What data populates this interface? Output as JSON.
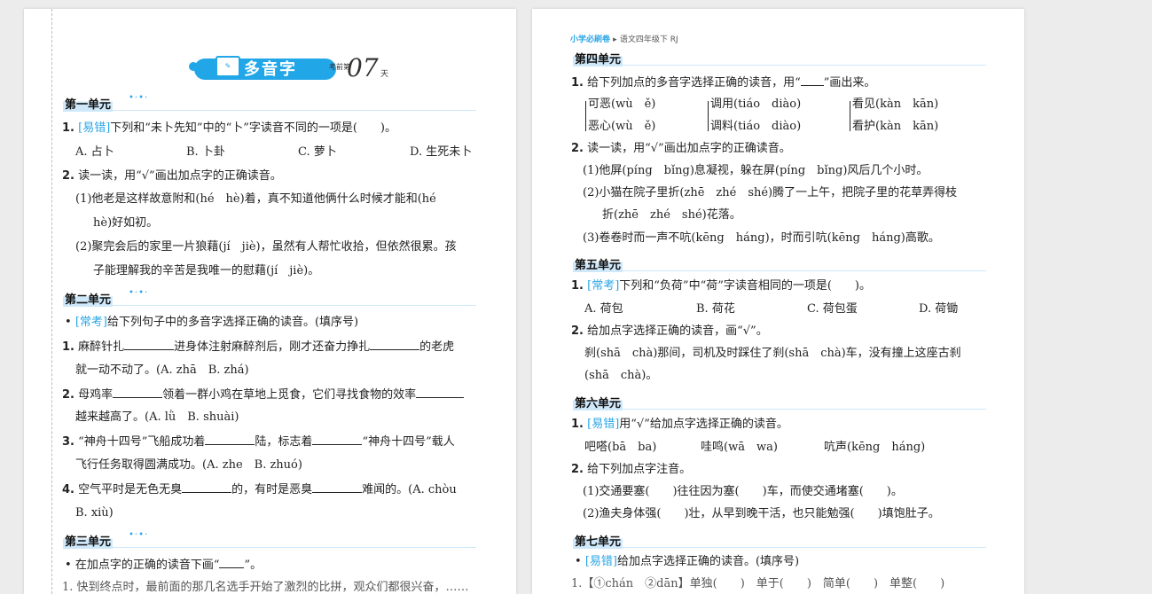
{
  "left": {
    "title": {
      "text": "多音字",
      "prefix": "考前第",
      "day": "07",
      "suffix": "天",
      "book_icon": "book-icon"
    },
    "u1": {
      "heading": "第一单元",
      "q1": {
        "num": "1.",
        "tag": "[易错]",
        "text": "下列和“未卜先知”中的“卜”字读音不同的一项是(　　)。",
        "opts": [
          "A. 占卜",
          "B. 卜卦",
          "C. 萝卜",
          "D. 生死未卜"
        ]
      },
      "q2": {
        "num": "2.",
        "text": "读一读，用“√”画出加点字的正确读音。",
        "s1a": "(1)他老是这样故意附和(hé　hè)着，真不知道他俩什么时候才能和(hé",
        "s1b": "hè)好如初。",
        "s2a": "(2)聚完会后的家里一片狼藉(jí　jiè)，虽然有人帮忙收拾，但依然很累。孩",
        "s2b": "子能理解我的辛苦是我唯一的慰藉(jí　jiè)。"
      }
    },
    "u2": {
      "heading": "第二单元",
      "intro": {
        "tag": "[常考]",
        "text": "给下列句子中的多音字选择正确的读音。(填序号)"
      },
      "q1": {
        "num": "1.",
        "a": "麻醉针扎",
        "b": "进身体注射麻醉剂后，刚才还奋力挣扎",
        "c": "的老虎",
        "d": "就一动不动了。(A. zhā　B. zhá)"
      },
      "q2": {
        "num": "2.",
        "a": "母鸡率",
        "b": "领着一群小鸡在草地上觅食，它们寻找食物的效率",
        "d": "越来越高了。(A. lǜ　B. shuài)"
      },
      "q3": {
        "num": "3.",
        "a": "“神舟十四号”飞船成功着",
        "b": "陆，标志着",
        "c": "“神舟十四号”载人",
        "d": "飞行任务取得圆满成功。(A. zhe　B. zhuó)"
      },
      "q4": {
        "num": "4.",
        "a": "空气平时是无色无臭",
        "b": "的，有时是恶臭",
        "c": "难闻的。(A. chòu",
        "d": "B. xiù)"
      }
    },
    "u3": {
      "heading": "第三单元",
      "intro": "在加点字的正确的读音下画“",
      "intro_end": "”。",
      "cut": "1. 快到终点时，最前面的那几名选手开始了激烈的比拼，观众们都很兴奋，……"
    }
  },
  "right": {
    "header": {
      "series": "小学必刷卷",
      "arrow": "▸",
      "grade": "语文四年级下 RJ"
    },
    "u4": {
      "heading": "第四单元",
      "q1": {
        "num": "1.",
        "a": "给下列加点的多音字选择正确的读音，用“",
        "b": "”画出来。",
        "row1": [
          "可恶(wù　ě)",
          "调用(tiáo　diào)",
          "看见(kàn　kān)"
        ],
        "row2": [
          "恶心(wù　ě)",
          "调料(tiáo　diào)",
          "看护(kàn　kān)"
        ]
      },
      "q2": {
        "num": "2.",
        "text": "读一读，用“√”画出加点字的正确读音。",
        "s1": "(1)他屏(píng　bǐng)息凝视，躲在屏(píng　bǐng)风后几个小时。",
        "s2a": "(2)小猫在院子里折(zhē　zhé　shé)腾了一上午，把院子里的花草弄得枝",
        "s2b": "折(zhē　zhé　shé)花落。",
        "s3": "(3)卷卷时而一声不吭(kēng　háng)，时而引吭(kēng　háng)高歌。"
      }
    },
    "u5": {
      "heading": "第五单元",
      "q1": {
        "num": "1.",
        "tag": "[常考]",
        "text": "下列和“负荷”中“荷”字读音相同的一项是(　　)。",
        "opts": [
          "A. 荷包",
          "B. 荷花",
          "C. 荷包蛋",
          "D. 荷锄"
        ]
      },
      "q2": {
        "num": "2.",
        "text": "给加点字选择正确的读音，画“√”。",
        "s1": "刹(shā　chà)那间，司机及时踩住了刹(shā　chà)车，没有撞上这座古刹",
        "s2": "(shā　chà)。"
      }
    },
    "u6": {
      "heading": "第六单元",
      "q1": {
        "num": "1.",
        "tag": "[易错]",
        "text": "用“√”给加点字选择正确的读音。",
        "opts": [
          "吧嗒(bā　ba)",
          "哇鸣(wā　wa)",
          "吭声(kēng　háng)"
        ]
      },
      "q2": {
        "num": "2.",
        "text": "给下列加点字注音。",
        "s1": "(1)交通要塞(　　)往往因为塞(　　)车，而使交通堵塞(　　)。",
        "s2": "(2)渔夫身体强(　　)壮，从早到晚干活，也只能勉强(　　)填饱肚子。"
      }
    },
    "u7": {
      "heading": "第七单元",
      "intro": {
        "tag": "[易错]",
        "text": "给加点字选择正确的读音。(填序号)"
      },
      "cut": "1.【①chán　②dān】单独(　　)　单于(　　)　简单(　　)　单整(　　)"
    }
  },
  "colors": {
    "accent": "#2aa5e6",
    "highlight": "#cfe9fb"
  }
}
